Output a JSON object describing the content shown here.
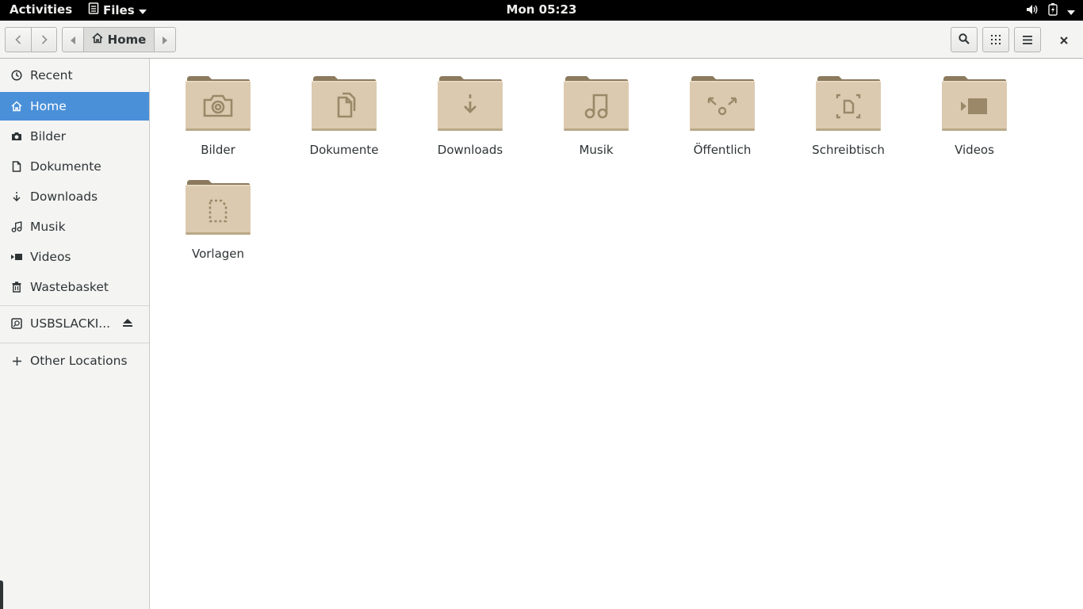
{
  "topbar": {
    "activities": "Activities",
    "app_menu": "Files",
    "clock": "Mon 05:23"
  },
  "headerbar": {
    "path_label": "Home"
  },
  "sidebar": {
    "places": [
      {
        "label": "Recent",
        "icon": "clock-icon"
      },
      {
        "label": "Home",
        "icon": "home-icon",
        "active": true
      },
      {
        "label": "Bilder",
        "icon": "camera-icon"
      },
      {
        "label": "Dokumente",
        "icon": "document-icon"
      },
      {
        "label": "Downloads",
        "icon": "download-icon"
      },
      {
        "label": "Musik",
        "icon": "music-icon"
      },
      {
        "label": "Videos",
        "icon": "video-icon"
      },
      {
        "label": "Wastebasket",
        "icon": "trash-icon"
      }
    ],
    "devices": [
      {
        "label": "USBSLACKI...",
        "icon": "drive-icon"
      }
    ],
    "other": {
      "label": "Other Locations",
      "icon": "plus-icon"
    }
  },
  "folders": [
    {
      "label": "Bilder",
      "emblem": "camera"
    },
    {
      "label": "Dokumente",
      "emblem": "documents"
    },
    {
      "label": "Downloads",
      "emblem": "download"
    },
    {
      "label": "Musik",
      "emblem": "music"
    },
    {
      "label": "Öffentlich",
      "emblem": "share"
    },
    {
      "label": "Schreibtisch",
      "emblem": "desktop"
    },
    {
      "label": "Videos",
      "emblem": "video"
    },
    {
      "label": "Vorlagen",
      "emblem": "template"
    }
  ],
  "colors": {
    "accent": "#4a90d9",
    "folder_body": "#dccab0",
    "folder_tab": "#8b7a5e",
    "emblem": "#9a8868"
  }
}
